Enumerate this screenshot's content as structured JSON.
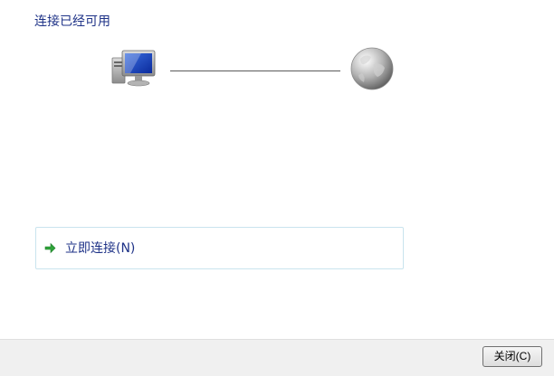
{
  "window": {
    "title": "连接已经可用"
  },
  "diagram": {
    "left_icon": "computer-icon",
    "right_icon": "globe-icon",
    "connector": "network-line"
  },
  "action": {
    "icon": "green-arrow-icon",
    "label": "立即连接(N)"
  },
  "footer": {
    "close_label": "关闭(C)"
  },
  "colors": {
    "title_text": "#1e3287",
    "action_border": "#c9e4ee",
    "arrow_green": "#2fa43a",
    "footer_bg": "#f0f0f0"
  }
}
